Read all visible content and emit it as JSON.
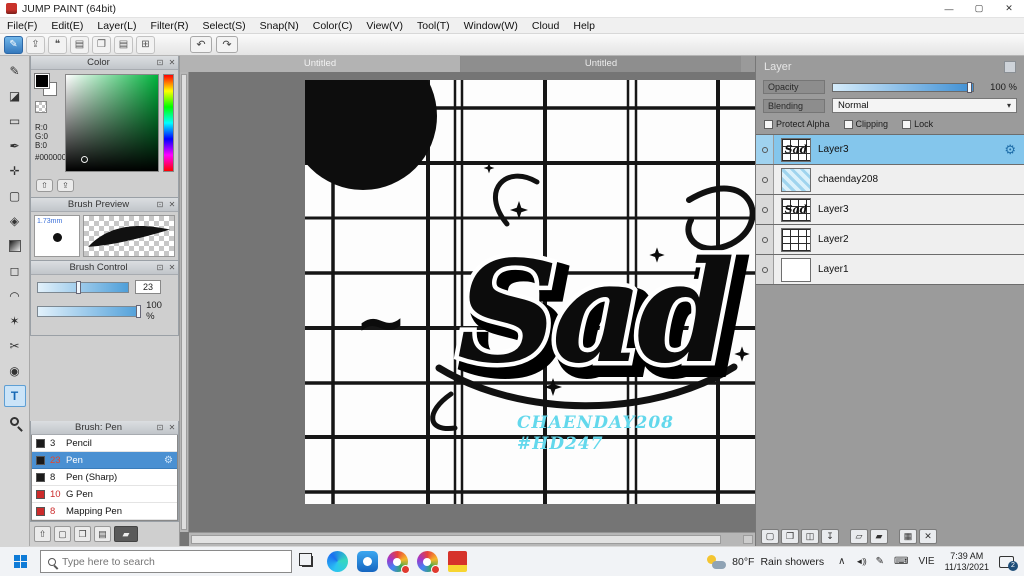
{
  "window": {
    "title": "JUMP PAINT (64bit)"
  },
  "icons": {
    "minimize": "—",
    "maximize": "▢",
    "close": "✕",
    "pop": "⊡",
    "x": "✕",
    "paint": "✎",
    "export": "⇪",
    "chat": "❝",
    "doc": "▤",
    "stack": "❐",
    "grid": "⊞",
    "undo": "↶",
    "redo": "↷",
    "gear": "⚙",
    "dropdown": "▾",
    "tool_pen": "✎",
    "tool_eraser": "◪",
    "tool_shape": "▭",
    "tool_nib": "✒",
    "tool_move": "✛",
    "tool_select": "▢",
    "tool_fill": "◈",
    "tool_marquee": "◻",
    "tool_lasso": "◠",
    "tool_wand": "✶",
    "tool_knife": "✂",
    "tool_picker": "◉",
    "tool_text": "T",
    "cf_swap": "⇧",
    "cf_save": "⇪",
    "bf_up": "⇧",
    "bf_new": "▢",
    "bf_dup": "❐",
    "bf_doc": "▤",
    "lf_new": "▢",
    "lf_dup": "❐",
    "lf_copy": "◫",
    "lf_down": "↧",
    "lf_folder": "▱",
    "lf_folder2": "▰",
    "lf_grid": "▦",
    "lf_trash": "✕",
    "chev_up": "∧",
    "volume": "◄))",
    "tray_pen": "✎",
    "keyboard": "⌨"
  },
  "menu": {
    "items": [
      "File(F)",
      "Edit(E)",
      "Layer(L)",
      "Filter(R)",
      "Select(S)",
      "Snap(N)",
      "Color(C)",
      "View(V)",
      "Tool(T)",
      "Window(W)",
      "Cloud",
      "Help"
    ]
  },
  "color_panel": {
    "title": "Color",
    "r": "R:0",
    "g": "G:0",
    "b": "B:0",
    "hex": "#000000"
  },
  "brush_preview": {
    "title": "Brush Preview",
    "size": "1.73mm"
  },
  "brush_control": {
    "title": "Brush Control",
    "size_value": "23",
    "opacity_value": "100 %"
  },
  "brush_panel": {
    "title": "Brush: Pen",
    "items": [
      {
        "num": "3",
        "name": "Pencil",
        "chip": "#1b1b1b",
        "num_color": "#222222"
      },
      {
        "num": "23",
        "name": "Pen",
        "chip": "#1b1b1b",
        "num_color": "#e8472a"
      },
      {
        "num": "8",
        "name": "Pen (Sharp)",
        "chip": "#1b1b1b",
        "num_color": "#222222"
      },
      {
        "num": "10",
        "name": "G Pen",
        "chip": "#cc2b2b",
        "num_color": "#cc2b2b"
      },
      {
        "num": "8",
        "name": "Mapping Pen",
        "chip": "#cc2b2b",
        "num_color": "#cc2b2b"
      }
    ]
  },
  "canvas": {
    "tabs": [
      {
        "label": "Untitled"
      },
      {
        "label": "Untitled"
      }
    ],
    "artwork_text": "Sad",
    "tilde": "~",
    "watermark1": "CHAENDAY208",
    "watermark2": "#HD247",
    "watermark_color": "#63d8ec"
  },
  "layer_panel": {
    "title": "Layer",
    "opacity_label": "Opacity",
    "opacity_value": "100 %",
    "blending_label": "Blending",
    "blending_value": "Normal",
    "cb_protect": "Protect Alpha",
    "cb_clipping": "Clipping",
    "cb_lock": "Lock",
    "layers": [
      {
        "name": "Layer3"
      },
      {
        "name": "chaenday208"
      },
      {
        "name": "Layer3"
      },
      {
        "name": "Layer2"
      },
      {
        "name": "Layer1"
      }
    ]
  },
  "taskbar": {
    "search_placeholder": "Type here to search",
    "weather_temp": "80°F",
    "weather_desc": "Rain showers",
    "language": "VIE",
    "time": "7:39 AM",
    "date": "11/13/2021",
    "badge": "2"
  }
}
